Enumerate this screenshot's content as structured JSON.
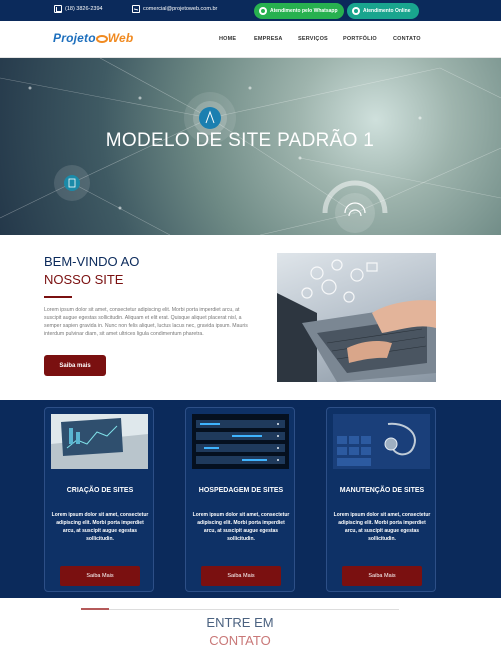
{
  "topbar": {
    "phone": "(18) 3826-2394",
    "email": "comercial@projetoweb.com.br",
    "whatsapp_label": "Atendimento pelo Whatsapp",
    "online_label": "Atendimento Online",
    "background": "#0b2a5b",
    "whatsapp_color": "#27b14f",
    "online_color": "#19a58e"
  },
  "header": {
    "logo": {
      "part1": "Projeto",
      "part2": "Web"
    },
    "nav": [
      "HOME",
      "EMPRESA",
      "SERVIÇOS",
      "PORTFÓLIO",
      "CONTATO"
    ]
  },
  "hero": {
    "title": "MODELO DE SITE PADRÃO 1"
  },
  "welcome": {
    "title_line1": "BEM-VINDO AO",
    "title_line2": "NOSSO SITE",
    "body": "Lorem ipsum dolor sit amet, consectetur adipiscing elit. Morbi porta imperdiet arcu, at suscipit augue egestas sollicitudin. Aliquam et elit erat. Quisque aliquet placerat nisl, a semper sapien gravida in. Nunc non felis aliquet, luctus lacus nec, gravida ipsum. Mauris interdum pulvinar diam, sit amet ultrices ligula condimentum pharetra.",
    "button": "Saiba mais",
    "accent": "#7a1010"
  },
  "services": {
    "cards": [
      {
        "title": "CRIAÇÃO DE SITES",
        "text": "Lorem ipsum dolor sit amet, consectetur adipiscing elit. Morbi porta imperdiet arcu, at suscipit augue egestas sollicitudin.",
        "button": "Saiba Mais",
        "image_icon": "laptop-charts-icon"
      },
      {
        "title": "HOSPEDAGEM DE SITES",
        "text": "Lorem ipsum dolor sit amet, consectetur adipiscing elit. Morbi porta imperdiet arcu, at suscipit augue egestas sollicitudin.",
        "button": "Saiba Mais",
        "image_icon": "server-rack-icon"
      },
      {
        "title": "MANUTENÇÃO DE SITES",
        "text": "Lorem ipsum dolor sit amet, consectetur adipiscing elit. Morbi porta imperdiet arcu, at suscipit augue egestas sollicitudin.",
        "button": "Saiba Mais",
        "image_icon": "keyboard-stethoscope-icon"
      }
    ],
    "background": "#0b2a5b"
  },
  "contact": {
    "title_line1": "ENTRE EM",
    "title_line2": "CONTATO"
  }
}
